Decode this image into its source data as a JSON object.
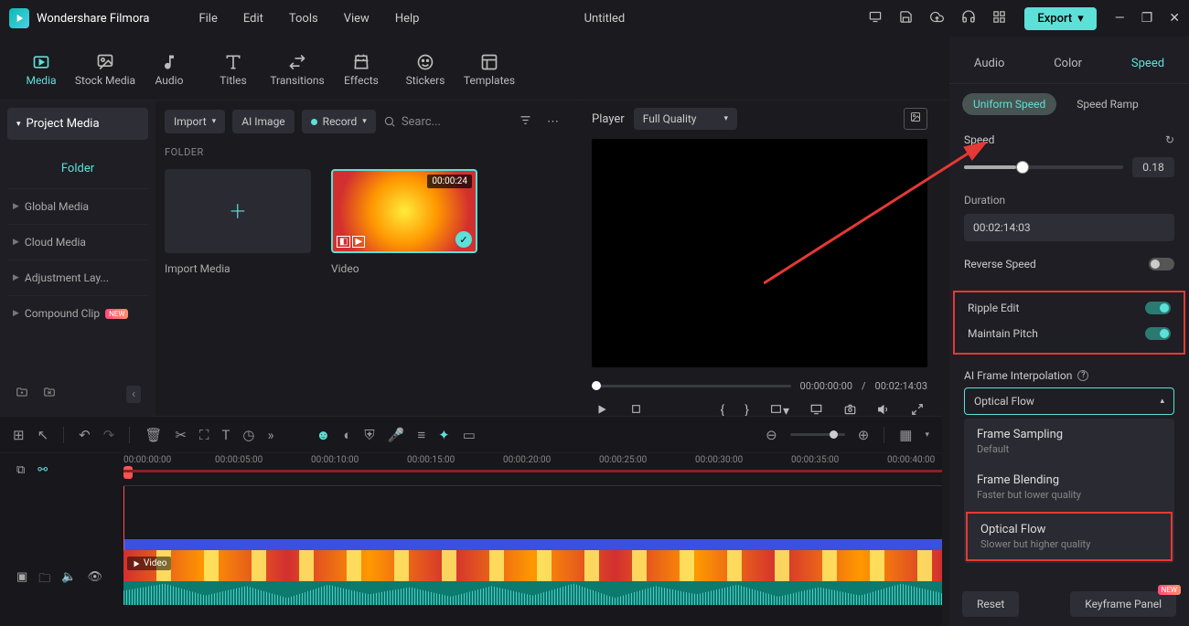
{
  "app": {
    "name": "Wondershare Filmora",
    "title": "Untitled",
    "menus": [
      "File",
      "Edit",
      "Tools",
      "View",
      "Help"
    ],
    "export": "Export"
  },
  "tool_tabs": [
    {
      "label": "Media",
      "active": true
    },
    {
      "label": "Stock Media"
    },
    {
      "label": "Audio"
    },
    {
      "label": "Titles"
    },
    {
      "label": "Transitions"
    },
    {
      "label": "Effects"
    },
    {
      "label": "Stickers"
    },
    {
      "label": "Templates"
    }
  ],
  "left": {
    "project_media": "Project Media",
    "folder": "Folder",
    "items": [
      "Global Media",
      "Cloud Media",
      "Adjustment Lay...",
      "Compound Clip"
    ],
    "new_badge": "NEW"
  },
  "center": {
    "import": "Import",
    "ai_image": "AI Image",
    "record": "Record",
    "search_placeholder": "Searc...",
    "folder_heading": "FOLDER",
    "import_media": "Import Media",
    "video_label": "Video",
    "video_dur": "00:00:24"
  },
  "preview": {
    "player": "Player",
    "quality": "Full Quality",
    "cur_time": "00:00:00:00",
    "sep": "/",
    "total_time": "00:02:14:03"
  },
  "props": {
    "tabs": [
      "Audio",
      "Color",
      "Speed"
    ],
    "subtabs": [
      "Uniform Speed",
      "Speed Ramp"
    ],
    "speed_label": "Speed",
    "speed_val": "0.18",
    "duration_label": "Duration",
    "duration_val": "00:02:14:03",
    "reverse": "Reverse Speed",
    "ripple": "Ripple Edit",
    "pitch": "Maintain Pitch",
    "ai_frame": "AI Frame Interpolation",
    "select_val": "Optical Flow",
    "options": [
      {
        "t": "Frame Sampling",
        "s": "Default"
      },
      {
        "t": "Frame Blending",
        "s": "Faster but lower quality"
      },
      {
        "t": "Optical Flow",
        "s": "Slower but higher quality"
      }
    ],
    "reset": "Reset",
    "keyframe": "Keyframe Panel",
    "new": "NEW"
  },
  "timeline": {
    "cur": "00:00:00:00",
    "ticks": [
      "00:00:05:00",
      "00:00:10:00",
      "00:00:15:00",
      "00:00:20:00",
      "00:00:25:00",
      "00:00:30:00",
      "00:00:35:00",
      "00:00:40:00"
    ],
    "clip_label": "Video"
  }
}
